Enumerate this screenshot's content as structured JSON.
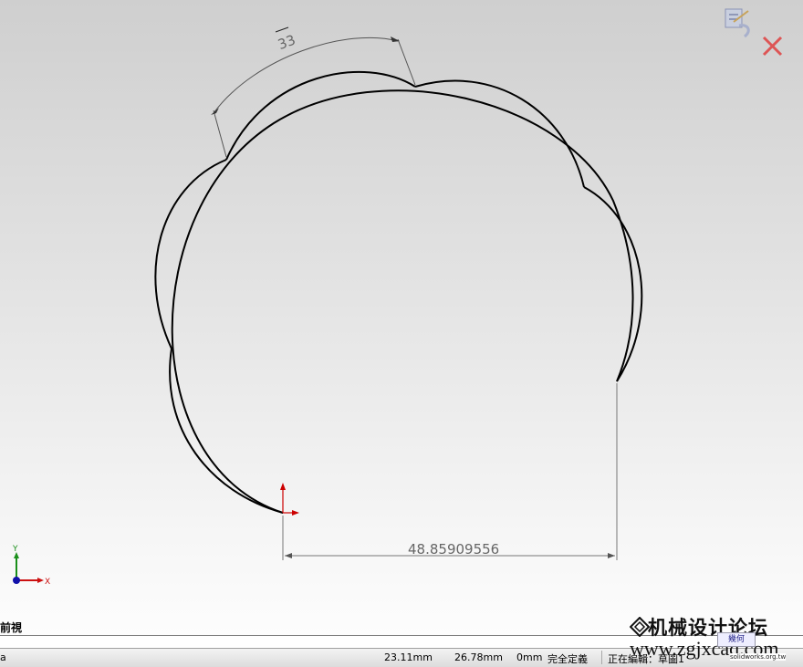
{
  "dimensions": {
    "angle_value": "33",
    "linear_value": "48.85909556"
  },
  "triad": {
    "y_label": "Y",
    "x_label": "X"
  },
  "view": {
    "name": "前視"
  },
  "status": {
    "x_coord": "23.11mm",
    "y_coord": "26.78mm",
    "z_coord": "0mm",
    "definition_state": "完全定義",
    "editing": "正在編輯：草圖1",
    "left_fragment": "a"
  },
  "watermark": {
    "forum_text": "机械设计论坛",
    "url": "www.zgjxcad.com",
    "badge_text": "幾何",
    "small_url": "solidworks.org.tw"
  },
  "icons": {
    "confirm_corner": "sketch-exit-icon",
    "cancel_corner": "cancel-x-icon",
    "origin": "origin-arrow-icon",
    "triad": "view-triad-icon"
  },
  "colors": {
    "sketch_line": "#000000",
    "dimension": "#555555",
    "origin_red": "#cc0000",
    "triad_green": "#1a8f1a",
    "triad_red": "#cc1111",
    "triad_blue": "#1111aa",
    "cancel_red": "#dd5555"
  }
}
